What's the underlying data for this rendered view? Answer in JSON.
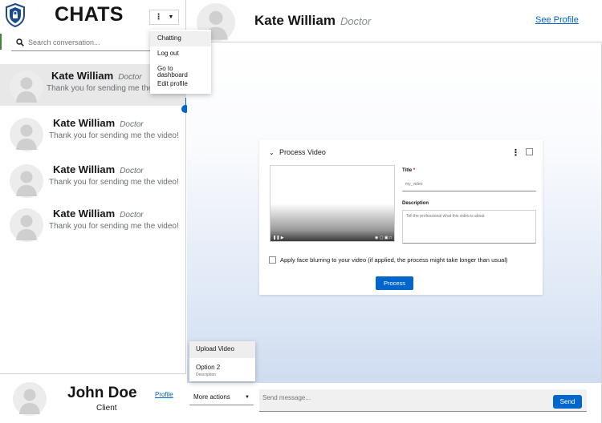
{
  "sidebar": {
    "title": "CHATS",
    "search": {
      "placeholder": "Search conversation..."
    },
    "menu": {
      "items": [
        {
          "label": "Chatting"
        },
        {
          "label": "Log out"
        },
        {
          "label": "Go to dashboard"
        },
        {
          "label": "Edit profile"
        }
      ],
      "active_item": "Chatting"
    },
    "conversations": [
      {
        "name": "Kate William",
        "role": "Doctor",
        "preview": "Thank you for sending me the video!",
        "active": true
      },
      {
        "name": "Kate William",
        "role": "Doctor",
        "preview": "Thank you for sending me the video!"
      },
      {
        "name": "Kate William",
        "role": "Doctor",
        "preview": "Thank you for sending me the video!"
      },
      {
        "name": "Kate William",
        "role": "Doctor",
        "preview": "Thank you for sending me the video!"
      }
    ],
    "profile": {
      "name": "John Doe",
      "role": "Client",
      "link": "Profile"
    }
  },
  "header": {
    "name": "Kate William",
    "role": "Doctor",
    "link": "See Profile"
  },
  "card": {
    "title": "Process Video",
    "title_label": "Title",
    "required_mark": "*",
    "title_placeholder": "my_video",
    "description_label": "Description",
    "description_placeholder": "Tell the professional what this video is about",
    "blur_label": "Apply face blurring to your video (if applied, the process might take longer than usual)",
    "process_label": "Process"
  },
  "more_menu": {
    "items": [
      {
        "label": "Upload Video"
      },
      {
        "label": "Option 2",
        "description": "Description"
      }
    ]
  },
  "composer": {
    "more_actions_label": "More actions",
    "message_placeholder": "Send message...",
    "send_label": "Send"
  },
  "colors": {
    "accent": "#0066cc",
    "active_row": "#e8e8e8",
    "logo": "#1a4b8c"
  },
  "icons": [
    "shield-lock-icon",
    "search-icon",
    "kebab-icon",
    "caret-down-icon",
    "avatar-icon",
    "chevron-down-icon",
    "checkbox-icon"
  ]
}
